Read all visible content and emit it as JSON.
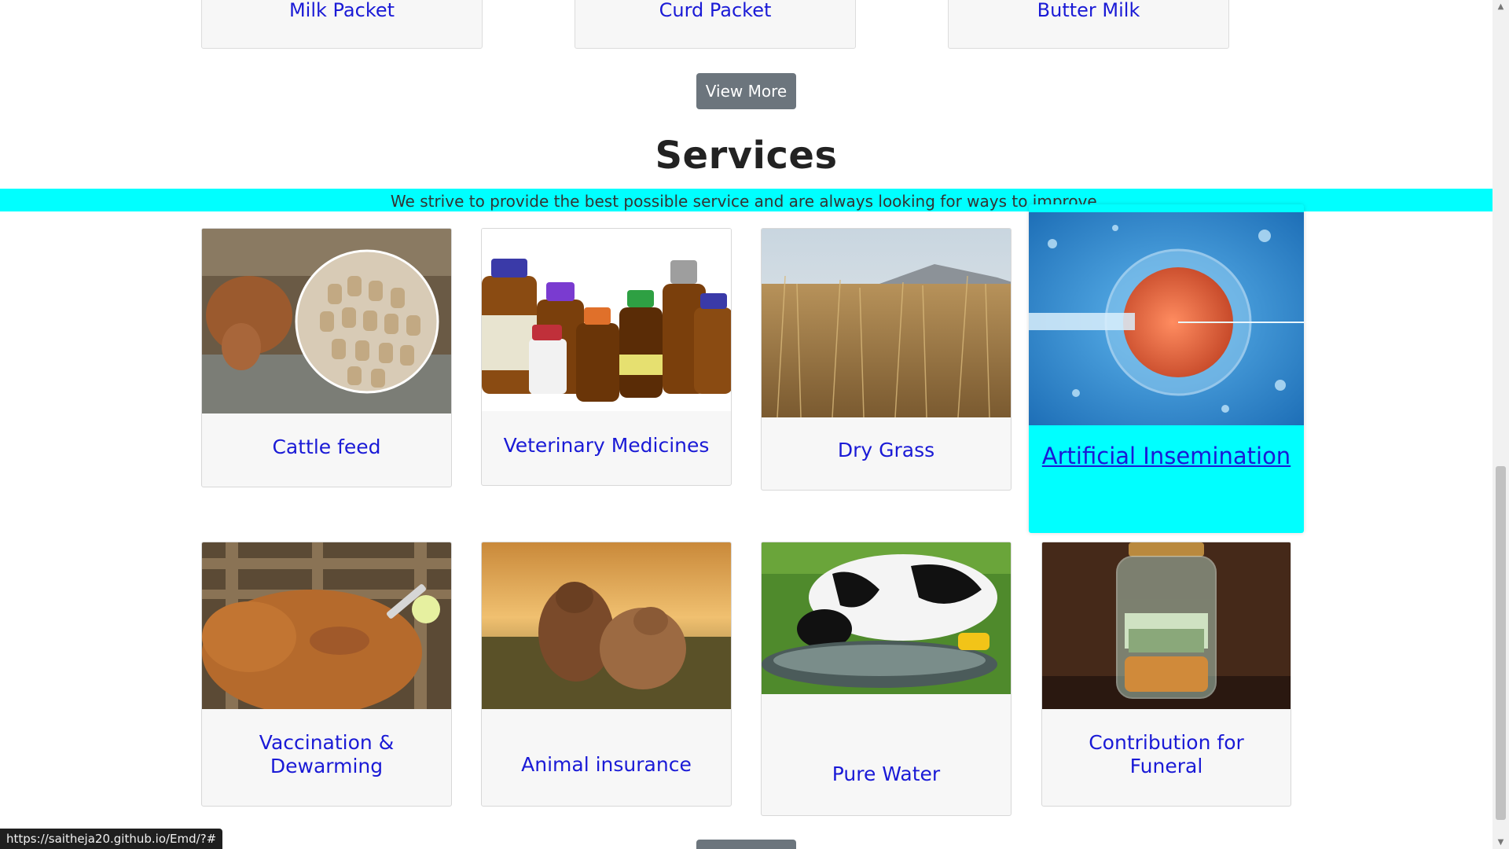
{
  "products": {
    "items": [
      "Milk Packet",
      "Curd Packet",
      "Butter Milk"
    ],
    "view_more_label": "View More"
  },
  "services": {
    "heading": "Services",
    "tagline": "We strive to provide the best possible service and are always looking for ways to improve.",
    "items": [
      {
        "title": "Cattle feed",
        "image": "cattle-feed-pellets-photo"
      },
      {
        "title": "Veterinary Medicines",
        "image": "medicine-bottles-photo"
      },
      {
        "title": "Dry Grass",
        "image": "dry-grass-field-photo"
      },
      {
        "title": "Artificial Insemination",
        "image": "cell-microinjection-photo"
      },
      {
        "title": "Vaccination & Dewarming",
        "image": "cow-vaccination-photo"
      },
      {
        "title": "Animal insurance",
        "image": "cows-in-field-photo"
      },
      {
        "title": "Pure Water",
        "image": "cow-drinking-water-photo"
      },
      {
        "title": "Contribution for Funeral",
        "image": "money-jar-photo"
      }
    ]
  },
  "status_bar": {
    "url": "https://saitheja20.github.io/Emd/?#"
  },
  "colors": {
    "accent_cyan": "#00ffff",
    "link_blue": "#1a1ad6",
    "button_gray": "#6c757d"
  }
}
